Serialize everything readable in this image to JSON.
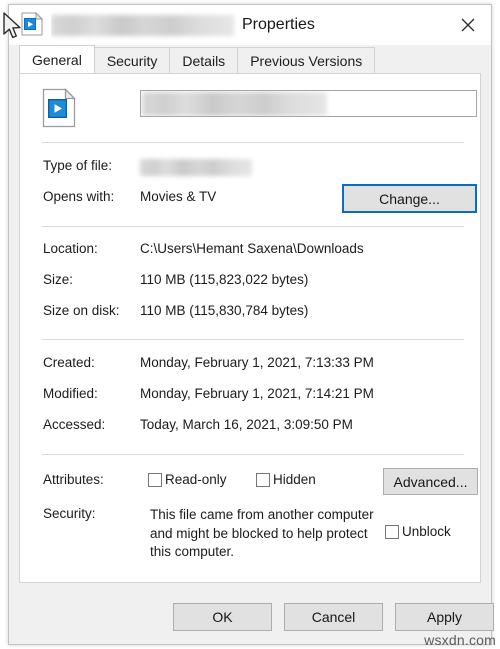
{
  "window": {
    "title_suffix": "Properties",
    "title_redacted": true,
    "icon": "video-file-icon",
    "close_label": "Close"
  },
  "tabs": [
    {
      "label": "General",
      "active": true
    },
    {
      "label": "Security",
      "active": false
    },
    {
      "label": "Details",
      "active": false
    },
    {
      "label": "Previous Versions",
      "active": false
    }
  ],
  "general": {
    "filename_value": "",
    "filename_redacted": true,
    "fields": [
      {
        "label": "Type of file:",
        "value": "",
        "redacted": true
      },
      {
        "label": "Opens with:",
        "value": "Movies & TV",
        "redacted": false
      },
      {
        "label": "Location:",
        "value": "C:\\Users\\Hemant Saxena\\Downloads",
        "redacted": false
      },
      {
        "label": "Size:",
        "value": "110 MB (115,823,022 bytes)",
        "redacted": false
      },
      {
        "label": "Size on disk:",
        "value": "110 MB (115,830,784 bytes)",
        "redacted": false
      },
      {
        "label": "Created:",
        "value": "Monday, February 1, 2021, 7:13:33 PM",
        "redacted": false
      },
      {
        "label": "Modified:",
        "value": "Monday, February 1, 2021, 7:14:21 PM",
        "redacted": false
      },
      {
        "label": "Accessed:",
        "value": "Today, March 16, 2021, 3:09:50 PM",
        "redacted": false
      }
    ],
    "change_button": "Change...",
    "attributes": {
      "label": "Attributes:",
      "readonly_label": "Read-only",
      "readonly_checked": false,
      "hidden_label": "Hidden",
      "hidden_checked": false,
      "advanced_button": "Advanced..."
    },
    "security": {
      "label": "Security:",
      "message": "This file came from another computer and might be blocked to help protect this computer.",
      "unblock_label": "Unblock",
      "unblock_checked": false
    }
  },
  "footer": {
    "ok": "OK",
    "cancel": "Cancel",
    "apply": "Apply"
  },
  "overlays": {
    "red_arrow_color": "#ee2d20",
    "accent_color": "#0f6cbd",
    "watermark": "wsxdn.com"
  }
}
